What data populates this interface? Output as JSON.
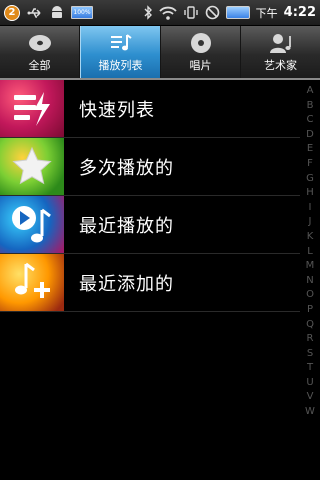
{
  "status_bar": {
    "badge_count": "2",
    "battery_small_label": "100%",
    "ampm": "下午",
    "time": "4:22"
  },
  "tabs": [
    {
      "label": "全部",
      "icon": "disc-icon",
      "active": false
    },
    {
      "label": "播放列表",
      "icon": "playlist-icon",
      "active": true
    },
    {
      "label": "唱片",
      "icon": "album-icon",
      "active": false
    },
    {
      "label": "艺术家",
      "icon": "artist-icon",
      "active": false
    }
  ],
  "playlists": [
    {
      "label": "快速列表",
      "icon": "quick-list-icon"
    },
    {
      "label": "多次播放的",
      "icon": "star-icon"
    },
    {
      "label": "最近播放的",
      "icon": "recent-played-icon"
    },
    {
      "label": "最近添加的",
      "icon": "recent-added-icon"
    }
  ],
  "index_letters": [
    "A",
    "B",
    "C",
    "D",
    "E",
    "F",
    "G",
    "H",
    "I",
    "J",
    "K",
    "L",
    "M",
    "N",
    "O",
    "P",
    "Q",
    "R",
    "S",
    "T",
    "U",
    "V",
    "W"
  ],
  "colors": {
    "active_tab": "#2e8fcf",
    "background": "#000000"
  }
}
